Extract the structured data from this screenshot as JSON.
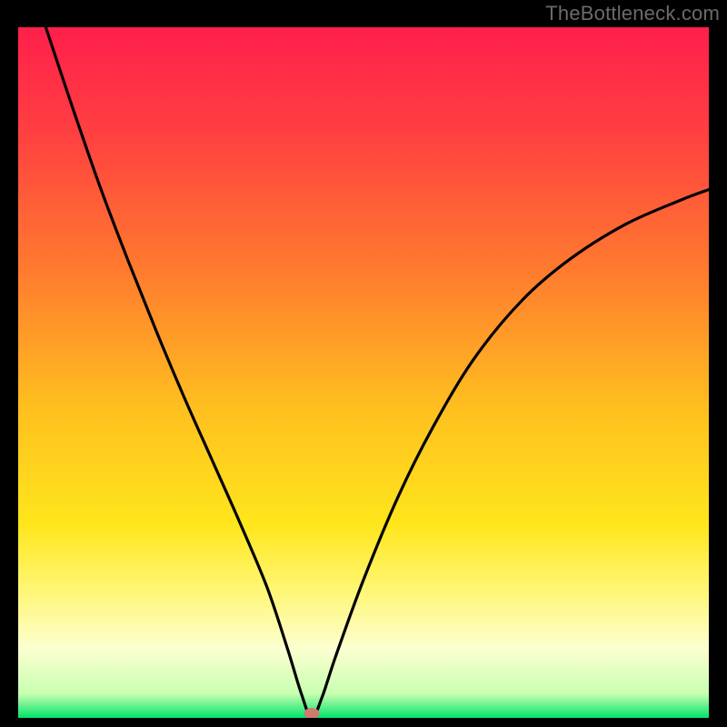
{
  "watermark": "TheBottleneck.com",
  "chart_data": {
    "type": "line",
    "title": "",
    "xlabel": "",
    "ylabel": "",
    "xlim": [
      0,
      100
    ],
    "ylim": [
      0,
      100
    ],
    "legend": false,
    "grid": false,
    "annotations": [
      "bottleneck-point"
    ],
    "background_gradient": {
      "type": "vertical",
      "stops": [
        {
          "pos": 0.0,
          "color": "#ff1f4b"
        },
        {
          "pos": 0.15,
          "color": "#ff3f41"
        },
        {
          "pos": 0.35,
          "color": "#ff7a2f"
        },
        {
          "pos": 0.55,
          "color": "#ffbf1f"
        },
        {
          "pos": 0.72,
          "color": "#ffe61c"
        },
        {
          "pos": 0.82,
          "color": "#fff77a"
        },
        {
          "pos": 0.9,
          "color": "#fcffd0"
        },
        {
          "pos": 0.965,
          "color": "#c8ffb0"
        },
        {
          "pos": 1.0,
          "color": "#00e36a"
        }
      ]
    },
    "marker": {
      "x": 42.5,
      "y": 0,
      "color": "#cf7b6d"
    },
    "series": [
      {
        "name": "bottleneck-curve",
        "color": "#000000",
        "points": [
          {
            "x": 4.0,
            "y": 100.0
          },
          {
            "x": 8.0,
            "y": 88.0
          },
          {
            "x": 12.0,
            "y": 76.5
          },
          {
            "x": 16.0,
            "y": 66.0
          },
          {
            "x": 20.0,
            "y": 56.0
          },
          {
            "x": 24.0,
            "y": 46.5
          },
          {
            "x": 28.0,
            "y": 37.5
          },
          {
            "x": 32.0,
            "y": 28.5
          },
          {
            "x": 36.0,
            "y": 19.0
          },
          {
            "x": 39.0,
            "y": 10.0
          },
          {
            "x": 41.0,
            "y": 3.5
          },
          {
            "x": 42.5,
            "y": 0.0
          },
          {
            "x": 44.0,
            "y": 3.0
          },
          {
            "x": 46.0,
            "y": 9.0
          },
          {
            "x": 50.0,
            "y": 20.0
          },
          {
            "x": 55.0,
            "y": 32.0
          },
          {
            "x": 60.0,
            "y": 42.0
          },
          {
            "x": 66.0,
            "y": 52.0
          },
          {
            "x": 73.0,
            "y": 60.5
          },
          {
            "x": 80.0,
            "y": 66.5
          },
          {
            "x": 88.0,
            "y": 71.5
          },
          {
            "x": 96.0,
            "y": 75.0
          },
          {
            "x": 100.0,
            "y": 76.5
          }
        ]
      }
    ]
  }
}
